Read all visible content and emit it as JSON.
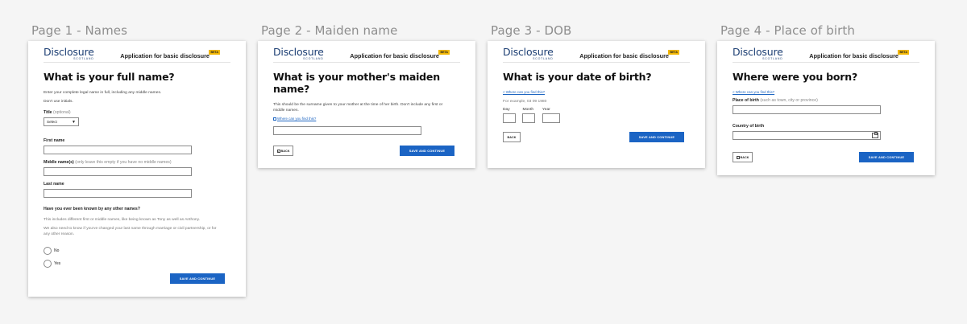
{
  "frames": [
    {
      "title": "Page 1 - Names"
    },
    {
      "title": "Page 2 - Maiden name"
    },
    {
      "title": "Page 3 - DOB"
    },
    {
      "title": "Page 4 - Place of birth"
    }
  ],
  "header": {
    "logo_main": "Disclosure",
    "logo_sub": "SCOTLAND",
    "app_title": "Application for basic disclosure",
    "beta": "BETA"
  },
  "page1": {
    "heading": "What is your full name?",
    "intro": "Enter your complete legal name in full, including any middle names.",
    "no_initials": "Don't use initials.",
    "title_label": "Title",
    "title_hint": "(optional)",
    "title_select": "Select",
    "first_name_label": "First name",
    "middle_names_label": "Middle name(s)",
    "middle_names_hint": "(only leave this empty if you have no middle names)",
    "last_name_label": "Last name",
    "other_names_question": "Have you ever been known by any other names?",
    "other_names_info1": "This includes different first or middle names, like being known as Tony as well as Anthony.",
    "other_names_info2": "We also need to know if you've changed your last name through marriage or civil partnership, or for any other reason.",
    "radio_no": "No",
    "radio_yes": "Yes",
    "continue": "SAVE AND CONTINUE"
  },
  "page2": {
    "heading": "What is your mother's maiden name?",
    "info": "This should be the surname given to your mother at the time of her birth. Don't include any first or middle names.",
    "link": "Where can you find this?",
    "back": "BACK",
    "continue": "SAVE AND CONTINUE"
  },
  "page3": {
    "heading": "What is your date of birth?",
    "link": "< Where can you find this?",
    "example": "For example, 03 09 1980",
    "day": "Day",
    "month": "Month",
    "year": "Year",
    "back": "BACK",
    "continue": "SAVE AND CONTINUE"
  },
  "page4": {
    "heading": "Where were you born?",
    "link": "< Where can you find this?",
    "place_label": "Place of birth",
    "place_hint": "(such as town, city or province)",
    "country_label": "Country of birth",
    "back": "BACK",
    "continue": "SAVE AND CONTINUE"
  },
  "colors": {
    "primary": "#1b64c4",
    "logo": "#1d3f74",
    "beta": "#f2b705",
    "link": "#1d65c1"
  }
}
